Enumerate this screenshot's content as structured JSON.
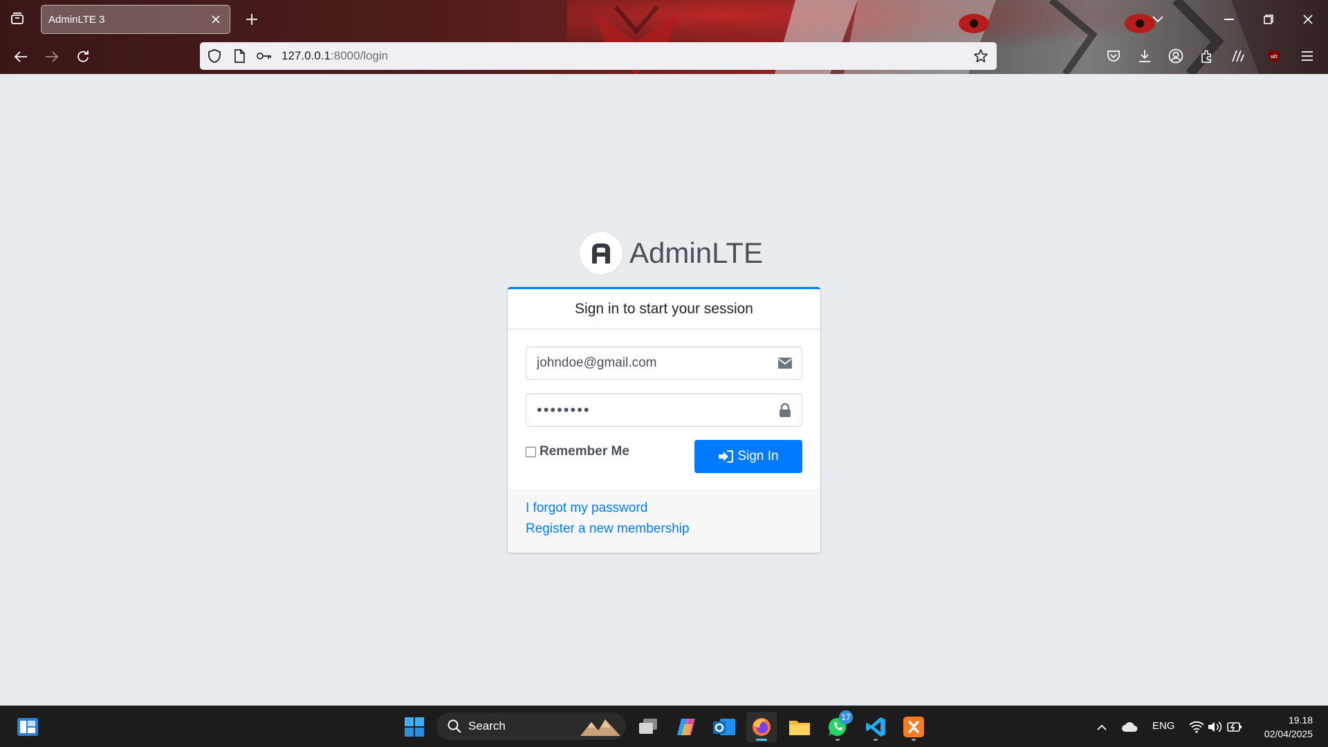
{
  "browser": {
    "tab_title": "AdminLTE 3",
    "url_host": "127.0.0.1",
    "url_path": ":8000/login"
  },
  "login": {
    "logo_bold": "Admin",
    "logo_light": "LTE",
    "card_title": "Sign in to start your session",
    "email_value": "johndoe@gmail.com",
    "password_value": "password",
    "remember_label": "Remember Me",
    "remember_checked": false,
    "signin_label": "Sign In",
    "forgot_link": "I forgot my password",
    "register_link": "Register a new membership"
  },
  "taskbar": {
    "search_placeholder": "Search",
    "whatsapp_badge": "17",
    "language": "ENG",
    "time": "19.18",
    "date": "02/04/2025"
  },
  "colors": {
    "primary": "#007bff",
    "page_bg": "#e9ecef",
    "taskbar_bg": "#1c1c1c"
  },
  "icons": [
    "tab-list-icon",
    "close-icon",
    "plus-icon",
    "chevron-down-icon",
    "minimize-icon",
    "restore-icon",
    "back-icon",
    "forward-icon",
    "reload-icon",
    "shield-icon",
    "page-icon",
    "key-icon",
    "star-icon",
    "pocket-icon",
    "download-icon",
    "account-icon",
    "extensions-icon",
    "reader-icon",
    "ublock-icon",
    "menu-icon",
    "envelope-icon",
    "lock-icon",
    "sign-in-icon",
    "windows-icon",
    "search-icon",
    "task-view-icon",
    "copilot-icon",
    "outlook-icon",
    "firefox-icon",
    "file-explorer-icon",
    "whatsapp-icon",
    "vscode-icon",
    "xampp-icon",
    "chevron-up-icon",
    "cloud-icon",
    "wifi-icon",
    "volume-icon",
    "battery-icon",
    "widgets-icon"
  ]
}
